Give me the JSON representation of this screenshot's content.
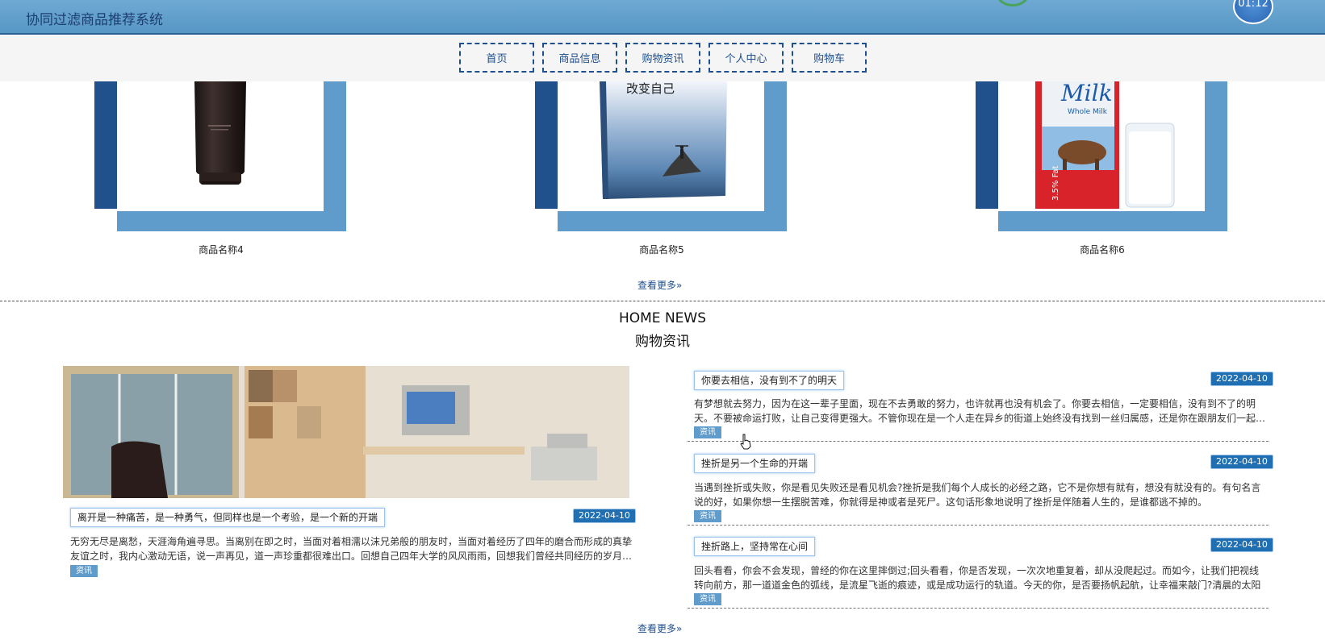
{
  "header": {
    "title": "协同过滤商品推荐系统",
    "timer": "01:12"
  },
  "nav": {
    "items": [
      {
        "label": "首页"
      },
      {
        "label": "商品信息"
      },
      {
        "label": "购物资讯"
      },
      {
        "label": "个人中心"
      },
      {
        "label": "购物车"
      }
    ]
  },
  "products": {
    "items": [
      {
        "name": "商品名称4"
      },
      {
        "name": "商品名称5",
        "book_title": "改变自己"
      },
      {
        "name": "商品名称6",
        "brand_text": "Milk",
        "brand_sub": "Whole Milk",
        "fat_text": "3.5% Fat"
      }
    ],
    "more_label": "查看更多»"
  },
  "news": {
    "heading_en": "HOME NEWS",
    "heading_cn": "购物资讯",
    "main": {
      "title": "离开是一种痛苦，是一种勇气，但同样也是一个考验，是一个新的开端",
      "date": "2022-04-10",
      "body": "无穷无尽是离愁，天涯海角遍寻思。当离别在即之时，当面对着相濡以沫兄弟般的朋友时，当面对着经历了四年的磨合而形成的真挚友谊之时，我内心激动无语，说一声再见，道一声珍重都很难出口。回想自己四年大学的风风雨雨，回想我们曾经共同经历的岁月…",
      "tag": "资讯"
    },
    "side": [
      {
        "title": "你要去相信，没有到不了的明天",
        "date": "2022-04-10",
        "body": "有梦想就去努力，因为在这一辈子里面，现在不去勇敢的努力，也许就再也没有机会了。你要去相信，一定要相信，没有到不了的明天。不要被命运打败，让自己变得更强大。不管你现在是一个人走在异乡的街道上始终没有找到一丝归属感，还是你在跟朋友们一起…",
        "tag": "资讯"
      },
      {
        "title": "挫折是另一个生命的开端",
        "date": "2022-04-10",
        "body": "当遇到挫折或失败，你是看见失败还是看见机会?挫折是我们每个人成长的必经之路，它不是你想有就有，想没有就没有的。有句名言说的好，如果你想一生摆脱苦难，你就得是神或者是死尸。这句话形象地说明了挫折是伴随着人生的，是谁都逃不掉的。",
        "tag": "资讯"
      },
      {
        "title": "挫折路上，坚持常在心间",
        "date": "2022-04-10",
        "body": "回头看看，你会不会发现，曾经的你在这里摔倒过;回头看看，你是否发现，一次次地重复着，却从没爬起过。而如今，让我们把视线转向前方，那一道道金色的弧线，是流星飞逝的痕迹，或是成功运行的轨道。今天的你，是否要扬帆起航，让幸福来敲门?清晨的太阳撒…",
        "tag": "资讯"
      }
    ],
    "more_label": "查看更多»"
  }
}
